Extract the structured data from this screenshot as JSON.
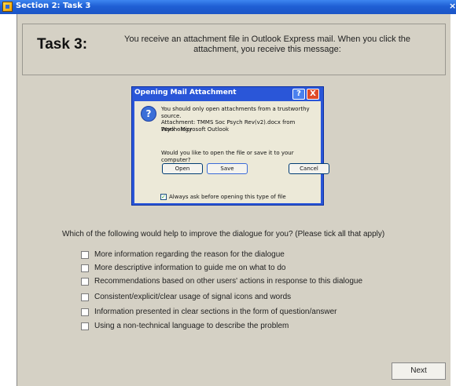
{
  "window": {
    "title": "Section 2: Task 3",
    "close_label": "×"
  },
  "task": {
    "title": "Task 3:",
    "description_line1": "You receive an attachment file in Outlook Express mail.  When you click the",
    "description_line2": "attachment, you receive this message:"
  },
  "dialog": {
    "title": "Opening Mail Attachment",
    "help_label": "?",
    "close_label": "X",
    "icon_glyph": "?",
    "warning": "You should only open attachments from a trustworthy source.",
    "attachment_line1": "Attachment: TMMS Soc Psych Rev(v2).docx from Psychology",
    "attachment_line2": "Work - Microsoft Outlook",
    "prompt": "Would you like to open the file or save it to your computer?",
    "open_label": "Open",
    "save_label": "Save",
    "cancel_label": "Cancel",
    "always_ask_label": "Always ask before opening this type of file",
    "always_ask_checked": true
  },
  "survey": {
    "question": "Which of the following would help to improve the dialogue for you? (Please tick all that apply)",
    "options": [
      {
        "label": "More information regarding the reason for the dialogue",
        "checked": false
      },
      {
        "label": "More descriptive information to guide me on what to do",
        "checked": false
      },
      {
        "label": "Recommendations based on other users' actions in response to this dialogue",
        "checked": false
      },
      {
        "label": "Consistent/explicit/clear usage of signal icons and words",
        "checked": false
      },
      {
        "label": "Information presented in clear sections in the form of question/answer",
        "checked": false
      },
      {
        "label": "Using a non-technical language to describe the problem",
        "checked": false
      }
    ]
  },
  "footer": {
    "next_label": "Next"
  }
}
